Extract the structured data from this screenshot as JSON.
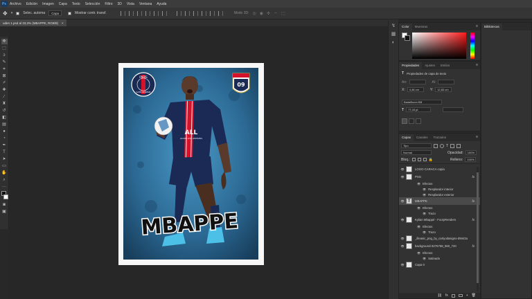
{
  "menubar": {
    "logo": "Ps",
    "items": [
      "Archivo",
      "Edición",
      "Imagen",
      "Capa",
      "Texto",
      "Selección",
      "Filtro",
      "3D",
      "Vista",
      "Ventana",
      "Ayuda"
    ]
  },
  "options": {
    "auto_select_label": "Selec. automa",
    "auto_select_target": "Capa",
    "show_transform_label": "Mostrar contr. transf.",
    "mode_3d_label": "Modo 3D:"
  },
  "doc_tab": {
    "title": "uden 1.psd al 33,3% (MBAPPE, RGB/8)",
    "close": "×"
  },
  "poster": {
    "player_name": "MBAPPE",
    "club_badge_top": "PARIS",
    "club_badge_bottom": "SAINT-GERMAIN",
    "crest_number": "09",
    "shirt_text": "ALL",
    "shirt_sub": "ACCOR LIVE LIMITLESS"
  },
  "colors": {
    "accent_blue": "#4aa3ff",
    "psg_navy": "#1a2a55",
    "psg_red": "#d4122b",
    "poster_blue": "#2f6f9a"
  },
  "color_panel": {
    "tabs": [
      "Color",
      "Muestras"
    ],
    "menu": "≡"
  },
  "library_panel": {
    "tabs": [
      "Bibliotecas"
    ]
  },
  "properties_panel": {
    "tabs": [
      "Propiedades",
      "Ajustes",
      "Estilos"
    ],
    "subtitle": "Propiedades de capa de texto",
    "an_label": "An:",
    "al_label": "Al:",
    "x_label": "X:",
    "x_value": "4,48 cm",
    "y_label": "Y:",
    "y_value": "12,83 cm",
    "font": "BadaBoom BB",
    "size": "77,43 pt"
  },
  "layers_panel": {
    "tabs": [
      "Capas",
      "Canales",
      "Trazados"
    ],
    "filter": "Tipo",
    "blend_mode": "Normal",
    "opacity_label": "Opacidad:",
    "opacity": "100%",
    "lock_label": "Bloq.:",
    "fill_label": "Relleno:",
    "fill": "100%",
    "layers": [
      {
        "name": "LOGO CARACA copia",
        "fx": false,
        "effects": []
      },
      {
        "name": "PSG",
        "fx": true,
        "effects": [
          "Efectos",
          "Resplandor interior",
          "Resplandor exterior"
        ]
      },
      {
        "name": "MBAPPE",
        "fx": true,
        "type": "text",
        "effects": [
          "Efectos",
          "Trazo"
        ]
      },
      {
        "name": "Kylian Mbappé - FootyRenders",
        "fx": true,
        "effects": [
          "Efectos",
          "Trazo"
        ]
      },
      {
        "name": "_illeasic_png_by_carlyodasigns-d9mt3u",
        "fx": false,
        "effects": []
      },
      {
        "name": "background-3276768_960_720",
        "fx": true,
        "effects": [
          "Efectos",
          "Satinado"
        ]
      },
      {
        "name": "Capa 0",
        "fx": false,
        "effects": []
      }
    ],
    "fx_label": "fx"
  }
}
